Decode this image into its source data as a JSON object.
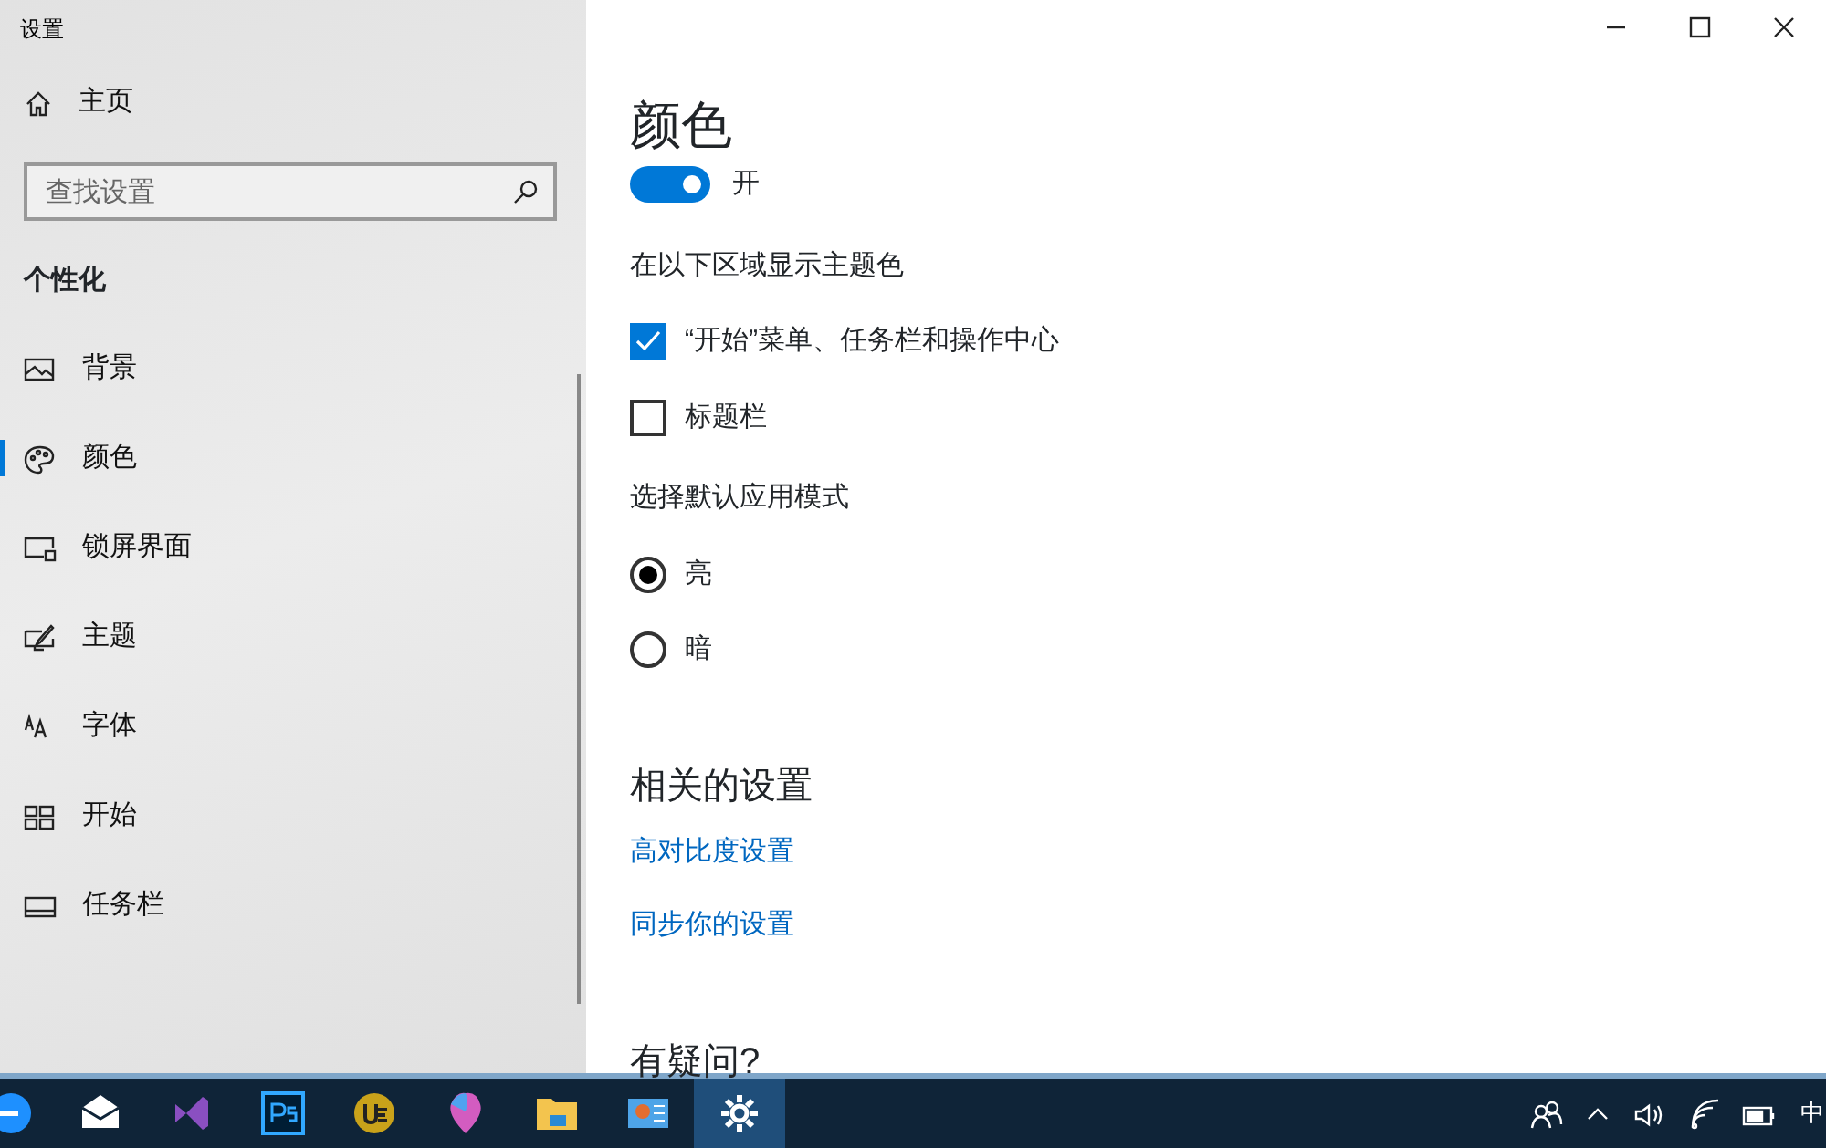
{
  "window": {
    "title": "设置"
  },
  "sidebar": {
    "home": {
      "label": "主页"
    },
    "search": {
      "placeholder": "查找设置"
    },
    "section_title": "个性化",
    "items": [
      {
        "label": "背景",
        "selected": false
      },
      {
        "label": "颜色",
        "selected": true
      },
      {
        "label": "锁屏界面",
        "selected": false
      },
      {
        "label": "主题",
        "selected": false
      },
      {
        "label": "字体",
        "selected": false
      },
      {
        "label": "开始",
        "selected": false
      },
      {
        "label": "任务栏",
        "selected": false
      }
    ]
  },
  "content": {
    "title": "颜色",
    "toggle": {
      "label": "开",
      "on": true
    },
    "accent_heading": "在以下区域显示主题色",
    "checkboxes": [
      {
        "label": "“开始”菜单、任务栏和操作中心",
        "checked": true
      },
      {
        "label": "标题栏",
        "checked": false
      }
    ],
    "mode_heading": "选择默认应用模式",
    "radios": [
      {
        "label": "亮",
        "selected": true
      },
      {
        "label": "暗",
        "selected": false
      }
    ],
    "related_heading": "相关的设置",
    "links": [
      "高对比度设置",
      "同步你的设置"
    ],
    "help_heading": "有疑问?"
  },
  "taskbar": {
    "apps": [
      {
        "selected": false
      },
      {
        "selected": false
      },
      {
        "selected": false
      },
      {
        "selected": false
      },
      {
        "selected": false
      },
      {
        "selected": false
      },
      {
        "selected": false
      },
      {
        "selected": false
      },
      {
        "selected": true
      }
    ],
    "ime": "中"
  }
}
